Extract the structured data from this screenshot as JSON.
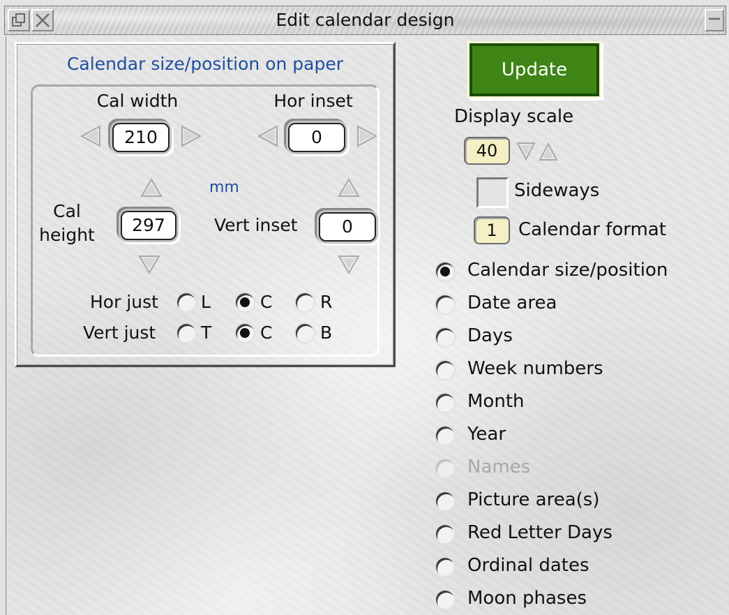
{
  "window": {
    "title": "Edit calendar design"
  },
  "size_group": {
    "title": "Calendar size/position on paper",
    "cal_width_label": "Cal width",
    "cal_width_value": "210",
    "hor_inset_label": "Hor inset",
    "hor_inset_value": "0",
    "unit": "mm",
    "cal_height_label_1": "Cal",
    "cal_height_label_2": "height",
    "cal_height_value": "297",
    "vert_inset_label": "Vert inset",
    "vert_inset_value": "0",
    "hor_just_label": "Hor just",
    "hor_just_options": [
      "L",
      "C",
      "R"
    ],
    "hor_just_selected": "C",
    "vert_just_label": "Vert just",
    "vert_just_options": [
      "T",
      "C",
      "B"
    ],
    "vert_just_selected": "C"
  },
  "controls": {
    "update_label": "Update",
    "update_color": "#3e8516",
    "display_scale_label": "Display scale",
    "display_scale_value": "40",
    "sideways_label": "Sideways",
    "sideways_checked": false,
    "calendar_format_value": "1",
    "calendar_format_label": "Calendar format"
  },
  "sections": {
    "selected": "Calendar size/position",
    "items": [
      {
        "label": "Calendar size/position",
        "enabled": true
      },
      {
        "label": "Date area",
        "enabled": true
      },
      {
        "label": "Days",
        "enabled": true
      },
      {
        "label": "Week numbers",
        "enabled": true
      },
      {
        "label": "Month",
        "enabled": true
      },
      {
        "label": "Year",
        "enabled": true
      },
      {
        "label": "Names",
        "enabled": false
      },
      {
        "label": "Picture area(s)",
        "enabled": true
      },
      {
        "label": "Red Letter Days",
        "enabled": true
      },
      {
        "label": "Ordinal dates",
        "enabled": true
      },
      {
        "label": "Moon phases",
        "enabled": true
      }
    ]
  }
}
